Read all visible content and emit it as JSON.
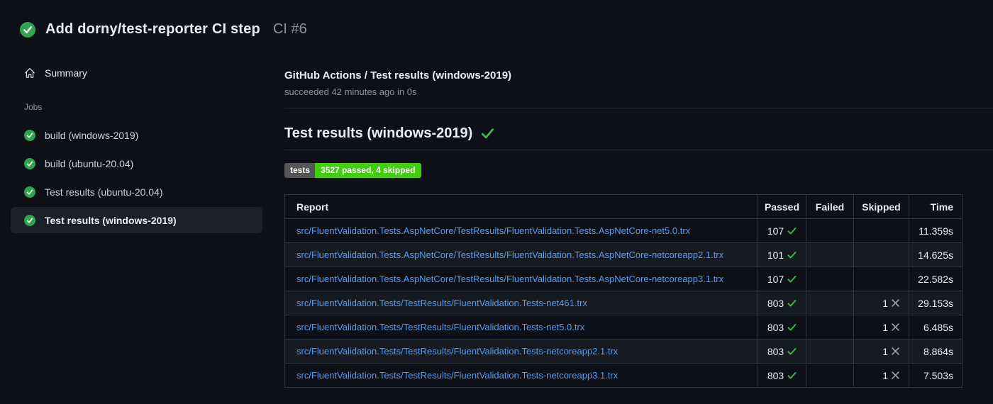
{
  "run_header": {
    "title": "Add dorny/test-reporter CI step",
    "run_number": "CI #6"
  },
  "sidebar": {
    "summary_label": "Summary",
    "jobs_section_label": "Jobs",
    "jobs": [
      {
        "label": "build (windows-2019)",
        "status": "success",
        "selected": false
      },
      {
        "label": "build (ubuntu-20.04)",
        "status": "success",
        "selected": false
      },
      {
        "label": "Test results (ubuntu-20.04)",
        "status": "success",
        "selected": false
      },
      {
        "label": "Test results (windows-2019)",
        "status": "success",
        "selected": true
      }
    ]
  },
  "main": {
    "check_title": "GitHub Actions / Test results (windows-2019)",
    "check_status": "succeeded 42 minutes ago in 0s",
    "heading": "Test results (windows-2019)",
    "heading_status": "success",
    "badge": {
      "label": "tests",
      "value": "3527 passed, 4 skipped"
    },
    "table": {
      "columns": [
        "Report",
        "Passed",
        "Failed",
        "Skipped",
        "Time"
      ],
      "rows": [
        {
          "report": "src/FluentValidation.Tests.AspNetCore/TestResults/FluentValidation.Tests.AspNetCore-net5.0.trx",
          "passed": "107",
          "failed": "",
          "skipped": "",
          "time": "11.359s"
        },
        {
          "report": "src/FluentValidation.Tests.AspNetCore/TestResults/FluentValidation.Tests.AspNetCore-netcoreapp2.1.trx",
          "passed": "101",
          "failed": "",
          "skipped": "",
          "time": "14.625s"
        },
        {
          "report": "src/FluentValidation.Tests.AspNetCore/TestResults/FluentValidation.Tests.AspNetCore-netcoreapp3.1.trx",
          "passed": "107",
          "failed": "",
          "skipped": "",
          "time": "22.582s"
        },
        {
          "report": "src/FluentValidation.Tests/TestResults/FluentValidation.Tests-net461.trx",
          "passed": "803",
          "failed": "",
          "skipped": "1",
          "time": "29.153s"
        },
        {
          "report": "src/FluentValidation.Tests/TestResults/FluentValidation.Tests-net5.0.trx",
          "passed": "803",
          "failed": "",
          "skipped": "1",
          "time": "6.485s"
        },
        {
          "report": "src/FluentValidation.Tests/TestResults/FluentValidation.Tests-netcoreapp2.1.trx",
          "passed": "803",
          "failed": "",
          "skipped": "1",
          "time": "8.864s"
        },
        {
          "report": "src/FluentValidation.Tests/TestResults/FluentValidation.Tests-netcoreapp3.1.trx",
          "passed": "803",
          "failed": "",
          "skipped": "1",
          "time": "7.503s"
        }
      ]
    }
  },
  "colors": {
    "success_circle_green": "#2ea44f",
    "check_green": "#3fb950",
    "badge_gray": "#555555",
    "badge_green": "#44cc11",
    "link_blue": "#539bf5",
    "page_background": "#0d1117",
    "row_alt_background": "#161b22",
    "border": "#30363d",
    "muted_text": "#8b949e"
  }
}
